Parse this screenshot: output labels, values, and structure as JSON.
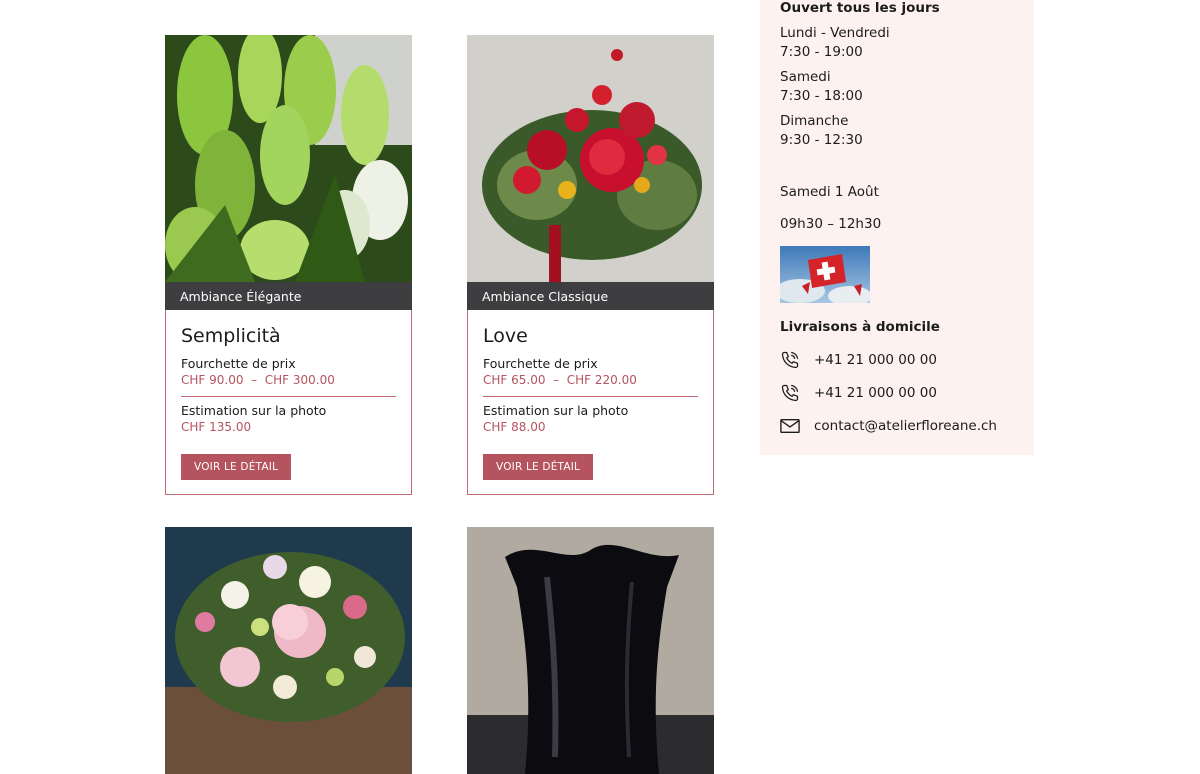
{
  "products": [
    {
      "ambiance": "Ambiance Élégante",
      "name": "Semplicità",
      "range_label": "Fourchette de prix",
      "range_low": "CHF 90.00",
      "range_sep": "–",
      "range_high": "CHF 300.00",
      "estimate_label": "Estimation sur la photo",
      "estimate": "CHF 135.00",
      "button": "VOIR LE DÉTAIL",
      "photo_icon": "white-lilies-photo"
    },
    {
      "ambiance": "Ambiance Classique",
      "name": "Love",
      "range_label": "Fourchette de prix",
      "range_low": "CHF 65.00",
      "range_sep": "–",
      "range_high": "CHF 220.00",
      "estimate_label": "Estimation sur la photo",
      "estimate": "CHF 88.00",
      "button": "VOIR LE DÉTAIL",
      "photo_icon": "red-rose-bouquet-photo"
    },
    {
      "photo_icon": "pastel-peony-bouquet-photo"
    },
    {
      "photo_icon": "black-vase-photo"
    }
  ],
  "sidebar": {
    "heading": "Ouvert tous les jours",
    "hours": [
      {
        "day": "Lundi - Vendredi",
        "time": "7:30 - 19:00"
      },
      {
        "day": "Samedi",
        "time": "7:30 - 18:00"
      },
      {
        "day": "Dimanche",
        "time": "9:30 - 12:30"
      }
    ],
    "special_day": "Samedi 1 Août",
    "special_hours": "09h30 – 12h30",
    "flag_image": "swiss-flag-photo",
    "delivery_heading": "Livraisons à domicile",
    "phone_1": "+41 21 000 00 00",
    "phone_2": "+41 21 000 00 00",
    "email": "contact@atelierfloreane.ch"
  },
  "colors": {
    "accent": "#b5545e",
    "band": "#3e3e41",
    "sidebar_bg": "#fdf2ef"
  }
}
